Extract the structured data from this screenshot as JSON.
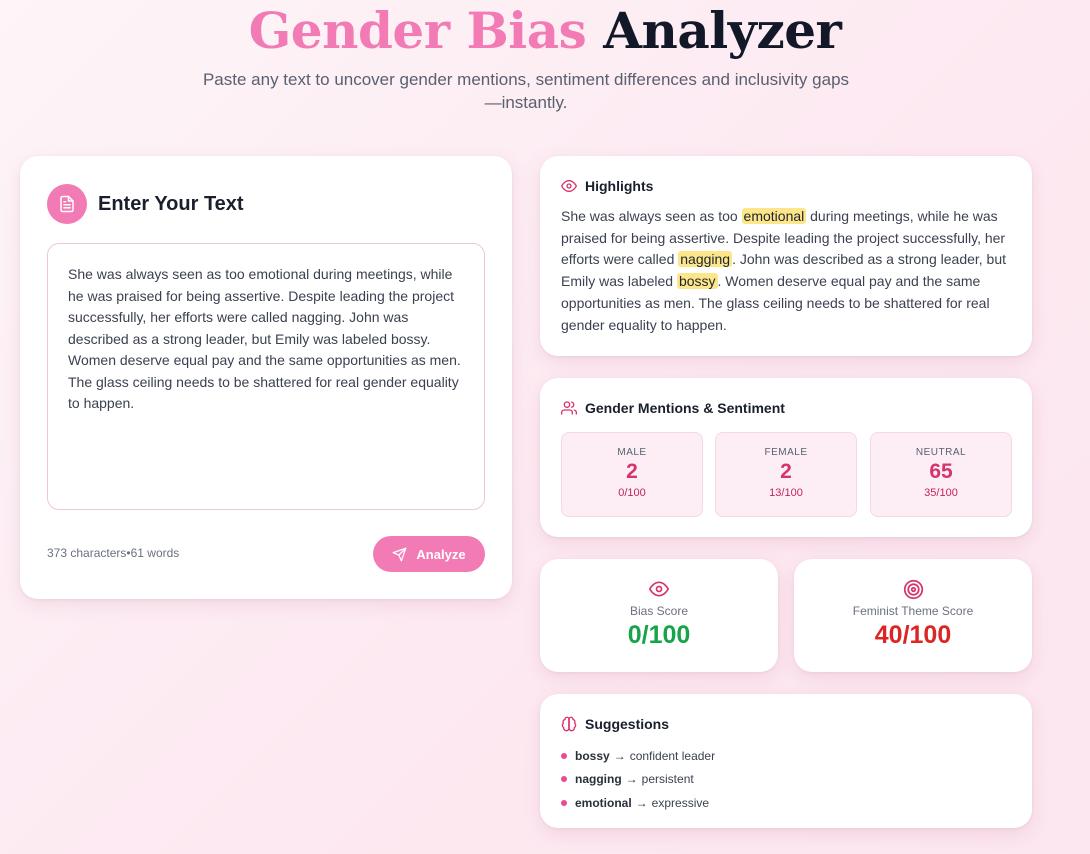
{
  "header": {
    "title_part1": "Gender Bias",
    "title_part2": "Analyzer",
    "subtitle": "Paste any text to uncover gender mentions, sentiment differences and inclusivity gaps—instantly."
  },
  "input": {
    "title": "Enter Your Text",
    "text": "She was always seen as too emotional during meetings, while he was praised for being assertive. Despite leading the project successfully, her efforts were called nagging. John was described as a strong leader, but Emily was labeled bossy. Women deserve equal pay and the same opportunities as men. The glass ceiling needs to be shattered for real gender equality to happen.",
    "characters": "373 characters",
    "separator": "•",
    "words": "61 words",
    "analyze_label": "Analyze"
  },
  "highlights": {
    "title": "Highlights",
    "segments": [
      {
        "text": "She was always seen as too ",
        "highlight": false
      },
      {
        "text": "emotional",
        "highlight": true
      },
      {
        "text": " during meetings, while he was praised for being assertive. Despite leading the project successfully, her efforts were called ",
        "highlight": false
      },
      {
        "text": "nagging",
        "highlight": true
      },
      {
        "text": ". John was described as a strong leader, but Emily was labeled ",
        "highlight": false
      },
      {
        "text": "bossy",
        "highlight": true
      },
      {
        "text": ". Women deserve equal pay and the same opportunities as men. The glass ceiling needs to be shattered for real gender equality to happen.",
        "highlight": false
      }
    ],
    "highlight_color": "#fde68a"
  },
  "mentions": {
    "title": "Gender Mentions & Sentiment",
    "stats": [
      {
        "label": "MALE",
        "count": "2",
        "sentiment": "0/100"
      },
      {
        "label": "FEMALE",
        "count": "2",
        "sentiment": "13/100"
      },
      {
        "label": "NEUTRAL",
        "count": "65",
        "sentiment": "35/100"
      }
    ]
  },
  "scores": {
    "bias": {
      "label": "Bias Score",
      "value": "0/100",
      "color": "#16a34a",
      "icon": "eye-icon"
    },
    "feminist": {
      "label": "Feminist Theme Score",
      "value": "40/100",
      "color": "#dc2626",
      "icon": "target-icon"
    }
  },
  "suggestions": {
    "title": "Suggestions",
    "arrow": "→",
    "items": [
      {
        "word": "bossy",
        "replacement": "confident leader"
      },
      {
        "word": "nagging",
        "replacement": "persistent"
      },
      {
        "word": "emotional",
        "replacement": "expressive"
      }
    ]
  },
  "colors": {
    "accent": "#f27bb5",
    "accent_dark": "#d6336c",
    "title_dark": "#121828"
  }
}
